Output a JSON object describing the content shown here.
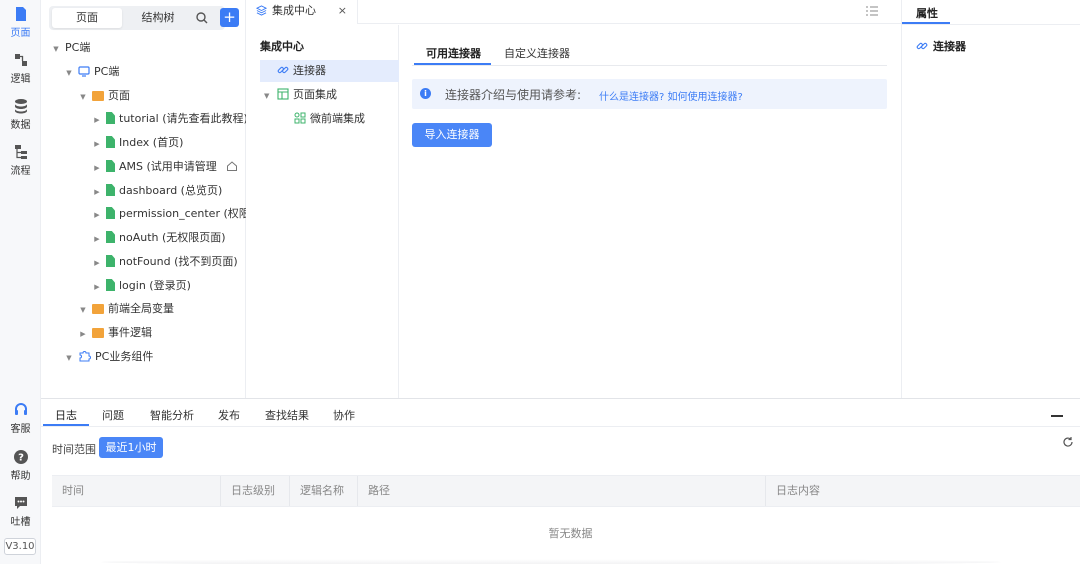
{
  "rail": {
    "items": [
      {
        "label": "页面",
        "icon": "page-icon"
      },
      {
        "label": "逻辑",
        "icon": "logic-icon"
      },
      {
        "label": "数据",
        "icon": "database-icon"
      },
      {
        "label": "流程",
        "icon": "flow-icon"
      }
    ],
    "bottom_items": [
      {
        "label": "客服",
        "icon": "headset-icon"
      },
      {
        "label": "帮助",
        "icon": "help-icon"
      },
      {
        "label": "吐槽",
        "icon": "feedback-icon"
      }
    ],
    "version": "V3.10"
  },
  "tree_panel": {
    "segments": [
      "页面",
      "结构树"
    ],
    "add_label": "+",
    "nodes": [
      {
        "label": "PC端",
        "caret": "▼"
      },
      {
        "label": "PC端",
        "caret": "▼"
      },
      {
        "label": "页面",
        "caret": "▼"
      },
      {
        "label": "tutorial (请先查看此教程)",
        "caret": "▶"
      },
      {
        "label": "Index (首页)",
        "caret": "▶"
      },
      {
        "label": "AMS (试用申请管理",
        "caret": "▶"
      },
      {
        "label": "dashboard (总览页)",
        "caret": "▶"
      },
      {
        "label": "permission_center (权限中",
        "caret": "▶"
      },
      {
        "label": "noAuth (无权限页面)",
        "caret": "▶"
      },
      {
        "label": "notFound (找不到页面)",
        "caret": "▶"
      },
      {
        "label": "login (登录页)",
        "caret": "▶"
      },
      {
        "label": "前端全局变量",
        "caret": "▼"
      },
      {
        "label": "事件逻辑",
        "caret": "▶"
      },
      {
        "label": "PC业务组件",
        "caret": "▼"
      }
    ]
  },
  "doc_tab": {
    "label": "集成中心",
    "close": "×"
  },
  "nav": {
    "title": "集成中心",
    "items": [
      {
        "label": "连接器",
        "caret": ""
      },
      {
        "label": "页面集成",
        "caret": "▼"
      },
      {
        "label": "微前端集成",
        "caret": ""
      }
    ]
  },
  "content": {
    "tabs": [
      "可用连接器",
      "自定义连接器"
    ],
    "info_icon": "i",
    "info_text": "连接器介绍与使用请参考:",
    "info_links": "什么是连接器? 如何使用连接器?",
    "import_button": "导入连接器"
  },
  "props": {
    "tab": "属性",
    "item": "连接器"
  },
  "bottom": {
    "tabs": [
      "日志",
      "问题",
      "智能分析",
      "发布",
      "查找结果",
      "协作"
    ],
    "range_label": "时间范围",
    "range_button": "最近1小时",
    "columns": [
      "时间",
      "日志级别",
      "逻辑名称",
      "路径",
      "日志内容"
    ],
    "empty_text": "暂无数据"
  },
  "colors": {
    "accent": "#3c7cf5",
    "folder": "#f2a33a",
    "page": "#3db36b"
  }
}
